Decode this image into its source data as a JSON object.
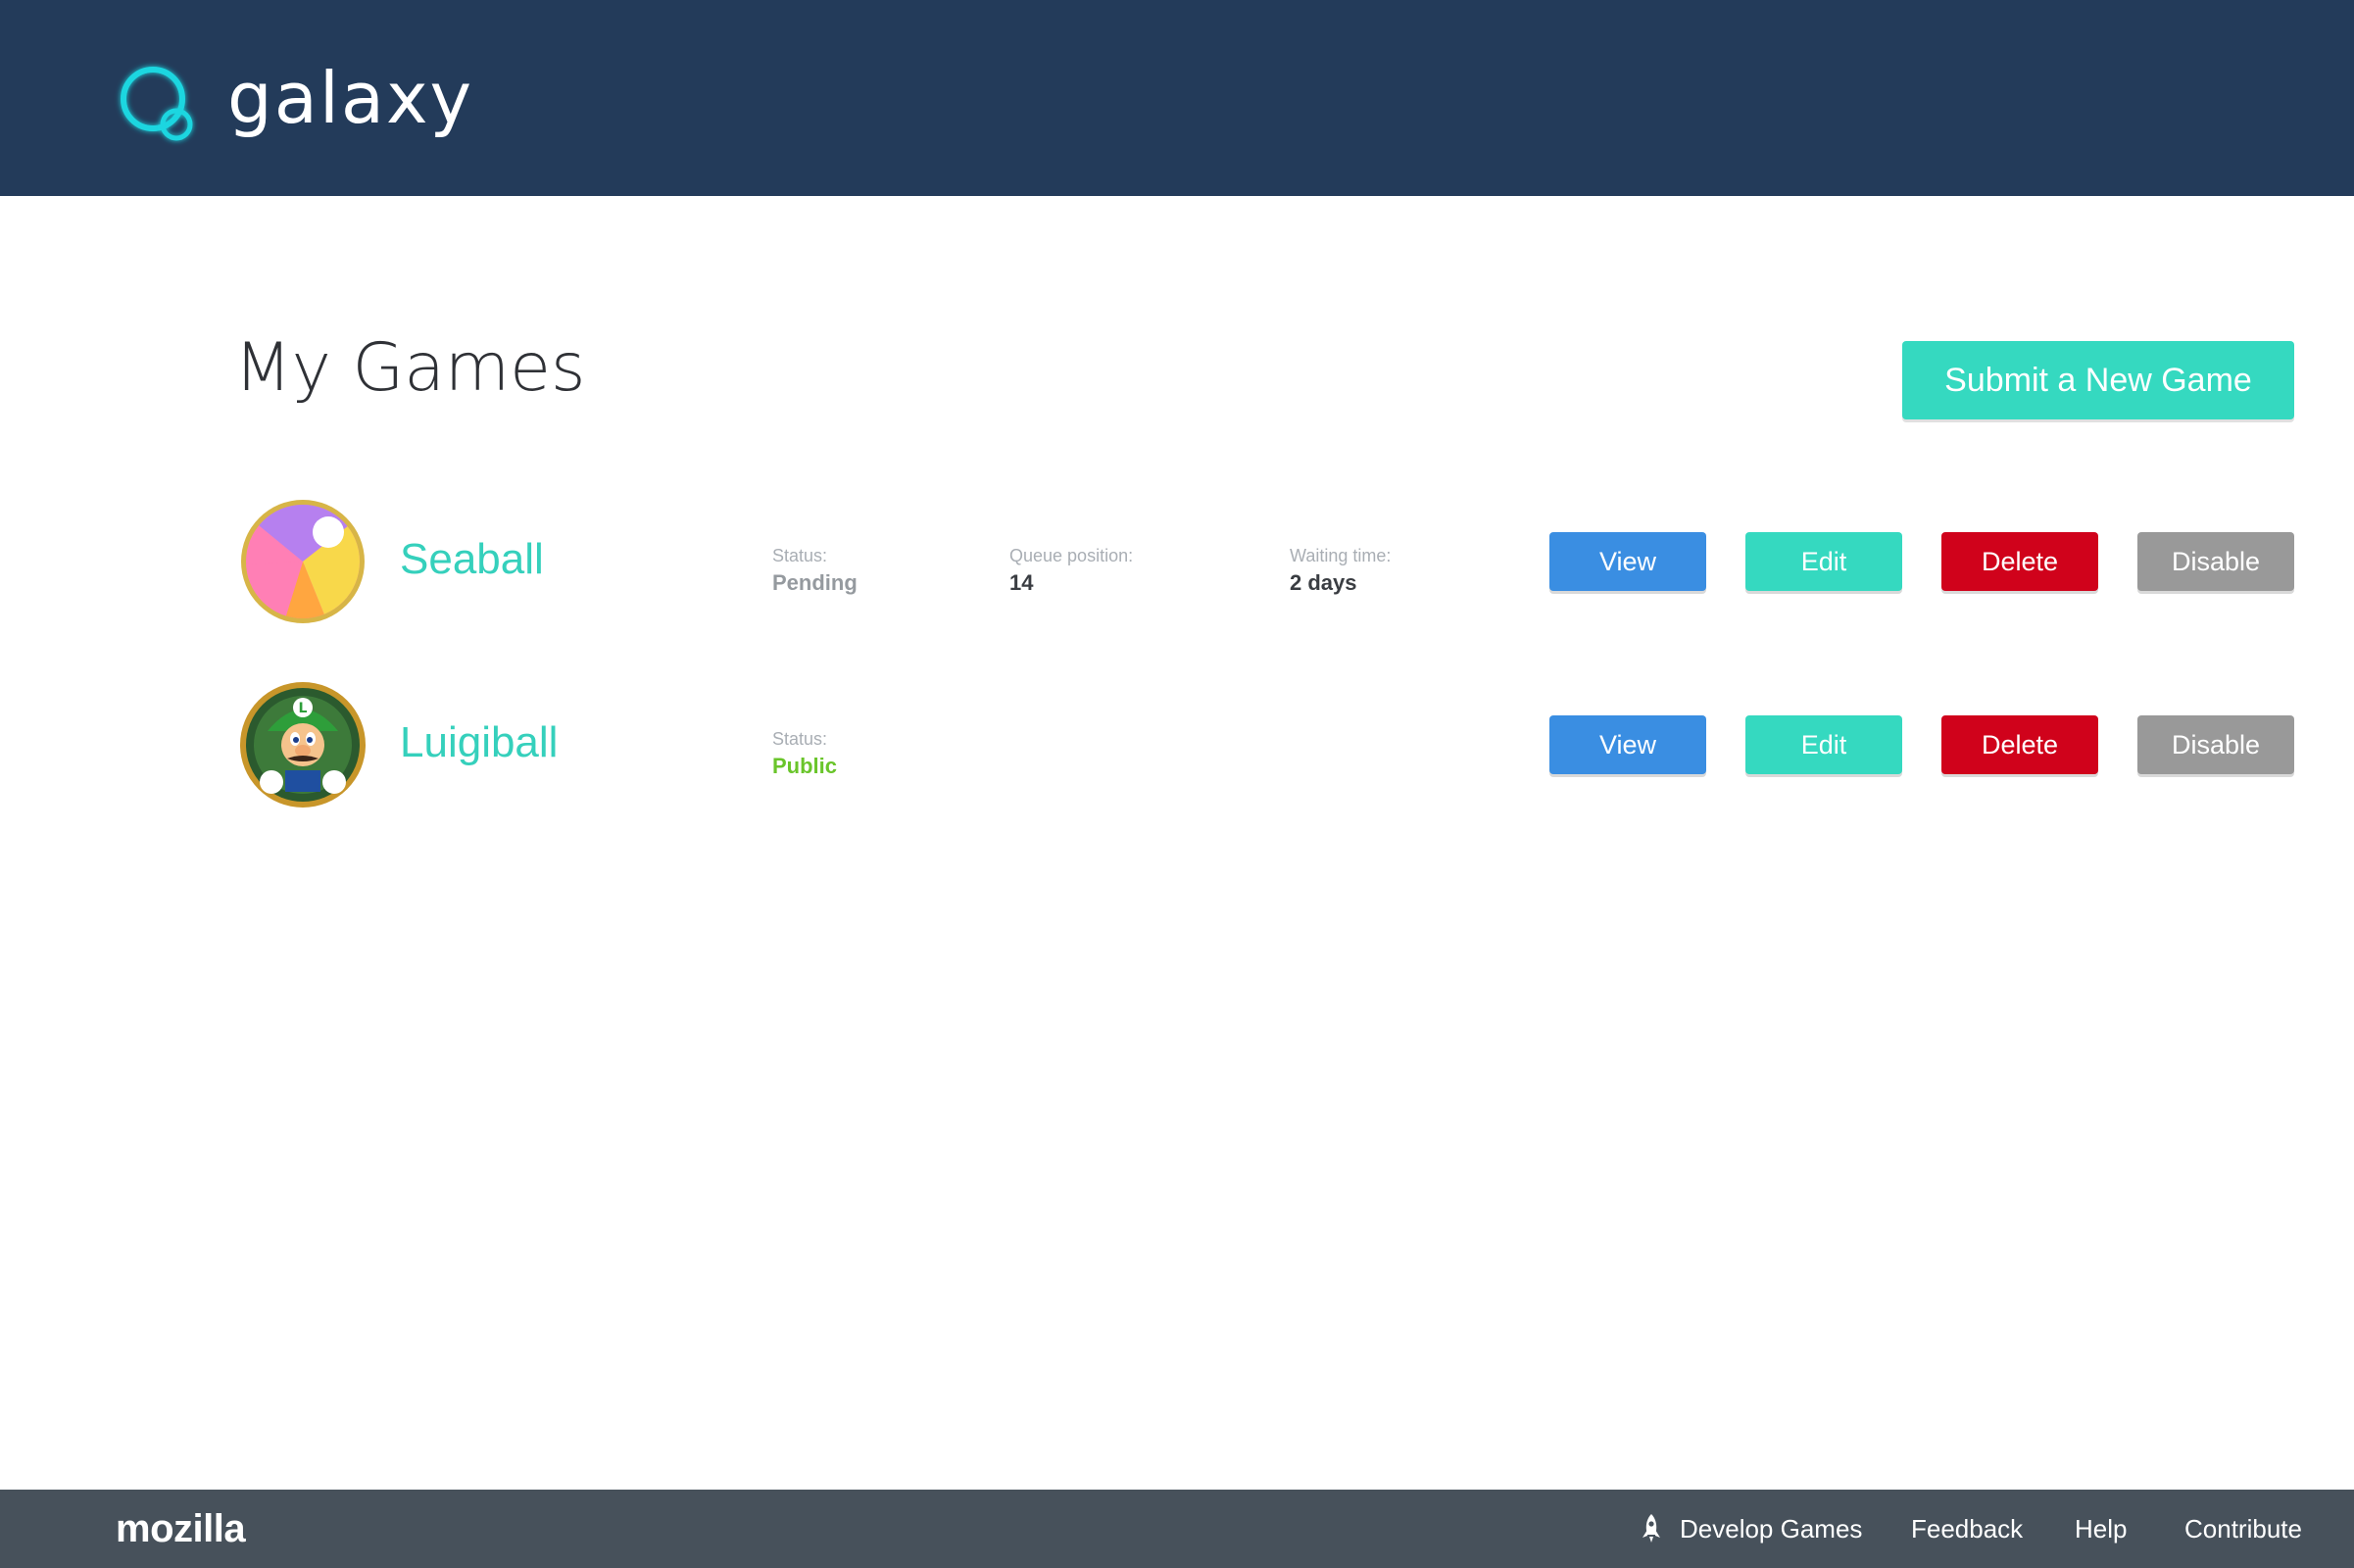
{
  "header": {
    "logo_text": "galaxy",
    "bg_color": "#233b5a",
    "logo_icon": "galaxy-orbit-icon"
  },
  "main": {
    "title": "My Games",
    "submit_label": "Submit a New Game",
    "accent_color": "#35d9c0"
  },
  "games": [
    {
      "name": "Seaball",
      "icon": "beach-ball-icon",
      "status_label": "Status:",
      "status": "Pending",
      "queue_label": "Queue position:",
      "queue": "14",
      "wait_label": "Waiting time:",
      "wait": "2 days"
    },
    {
      "name": "Luigiball",
      "icon": "luigi-avatar",
      "status_label": "Status:",
      "status": "Public"
    }
  ],
  "actions": {
    "view": "View",
    "edit": "Edit",
    "delete": "Delete",
    "disable": "Disable"
  },
  "colors": {
    "view": "#3a8ee2",
    "edit": "#35d9c0",
    "delete": "#d0021b",
    "disable": "#999999",
    "status_public": "#6ac52b"
  },
  "footer": {
    "brand": "mozilla",
    "links": [
      "Develop Games",
      "Feedback",
      "Help",
      "Contribute"
    ],
    "develop_icon": "rocket-icon"
  }
}
